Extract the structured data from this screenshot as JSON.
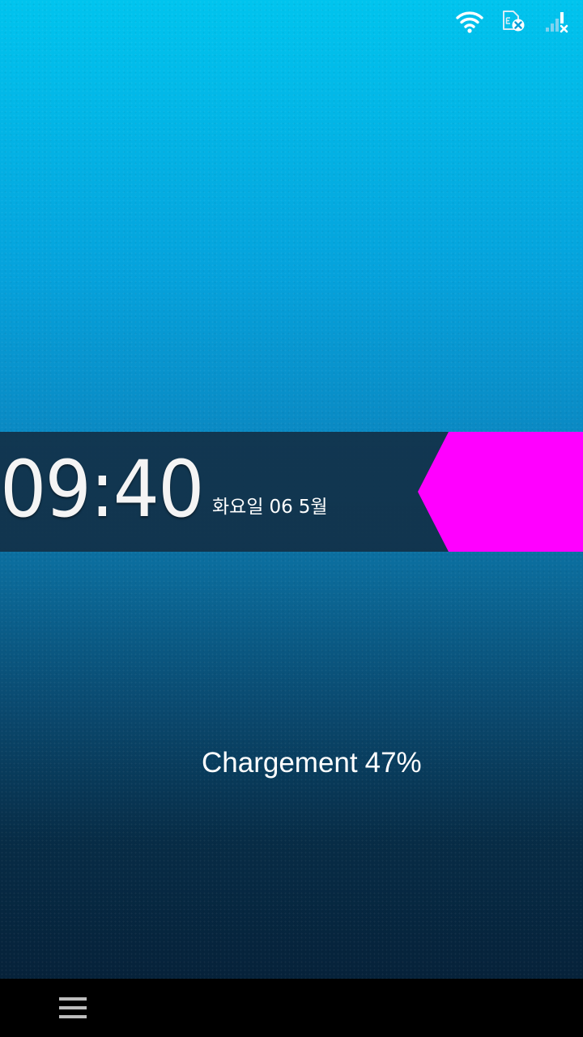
{
  "status_bar": {
    "icons": [
      "wifi-icon",
      "sim-card-error-icon",
      "cellular-signal-no-service-icon"
    ],
    "icon_color": "#ffffff"
  },
  "lockscreen": {
    "time": "09:40",
    "day": "화요일",
    "date_day": "06",
    "date_month": "5월",
    "unlock_tab_color": "#ff00ff",
    "band_color": "#123048"
  },
  "battery": {
    "label": "Chargement",
    "percent_text": "47%",
    "level_percent": 47
  },
  "nav_bar": {
    "icons": [
      "menu-icon"
    ]
  }
}
